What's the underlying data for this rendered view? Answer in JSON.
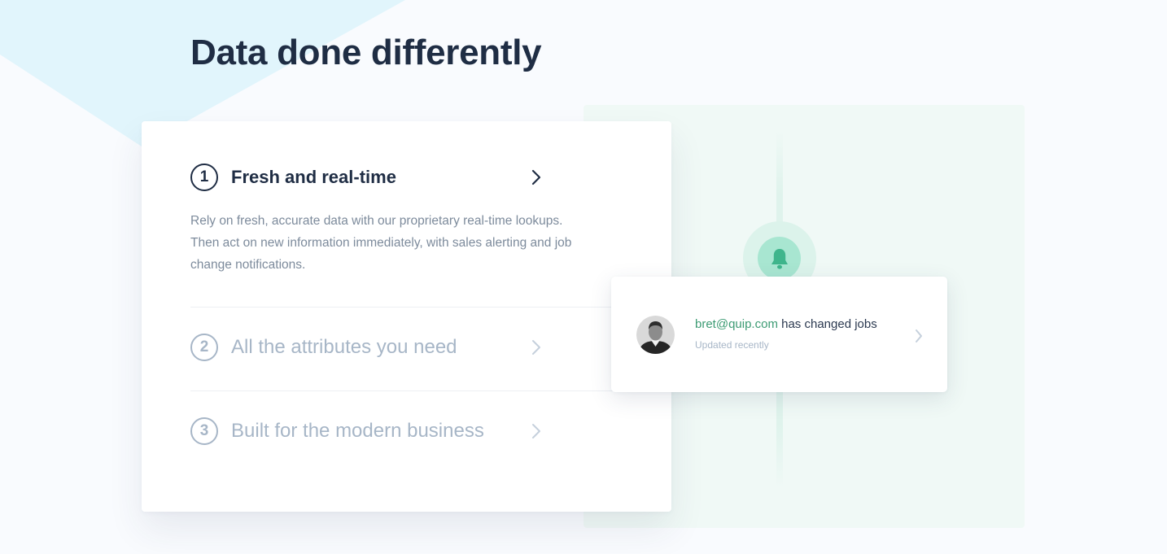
{
  "page": {
    "title": "Data done differently"
  },
  "features": [
    {
      "number": "1",
      "title": "Fresh and real-time",
      "description": "Rely on fresh, accurate data with our proprietary real-time lookups. Then act on new information immediately, with sales alerting and job change notifications.",
      "active": true,
      "icon": "chevron-right-icon"
    },
    {
      "number": "2",
      "title": "All the attributes you need",
      "active": false,
      "icon": "chevron-right-icon"
    },
    {
      "number": "3",
      "title": "Built for the modern business",
      "active": false,
      "icon": "chevron-right-icon"
    }
  ],
  "notification": {
    "email": "bret@quip.com",
    "message": "has changed jobs",
    "subtext": "Updated recently",
    "icon": "bell-icon",
    "avatar": "user-avatar"
  },
  "colors": {
    "heading": "#1f2d44",
    "muted": "#a7b6c7",
    "accent_green": "#3d9b74",
    "panel_bg": "#f0f9f6",
    "bell_bg": "#a8e6d1",
    "bg_shape": "#e2f5fc"
  }
}
